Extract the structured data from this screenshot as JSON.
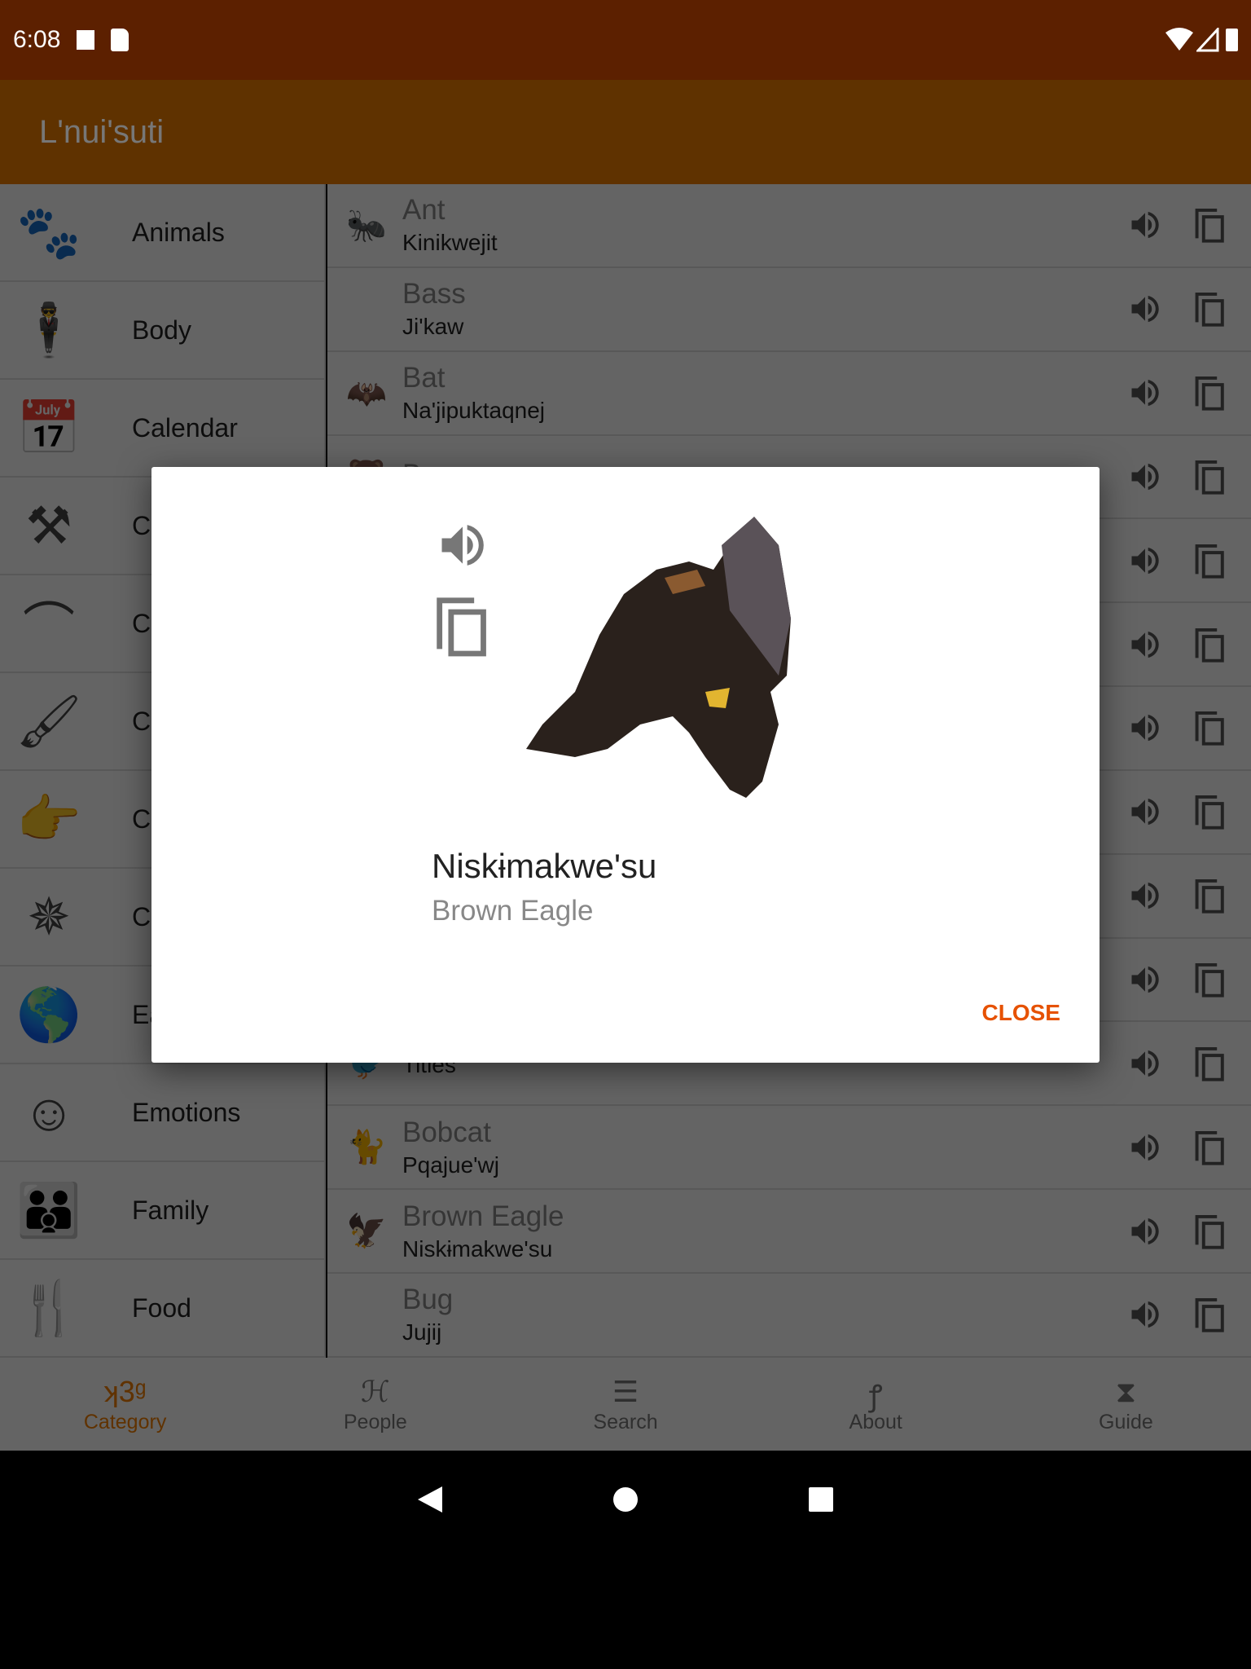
{
  "status_bar": {
    "time": "6:08"
  },
  "app_bar": {
    "title": "L'nui'suti"
  },
  "colors": {
    "status_bar": "#e65100",
    "app_bar": "#f07d00",
    "accent": "#e65100"
  },
  "sidebar": {
    "items": [
      {
        "label": "Animals",
        "icon": "animals-icon"
      },
      {
        "label": "Body",
        "icon": "body-icon"
      },
      {
        "label": "Calendar",
        "icon": "calendar-icon"
      },
      {
        "label": "Cl",
        "icon": "clans-icon"
      },
      {
        "label": "Cl",
        "icon": "hanger-icon"
      },
      {
        "label": "Co",
        "icon": "brush-icon"
      },
      {
        "label": "Co",
        "icon": "pointing-hand-icon"
      },
      {
        "label": "Co",
        "icon": "compass-icon"
      },
      {
        "label": "Ea",
        "icon": "globe-icon"
      },
      {
        "label": "Emotions",
        "icon": "faces-icon"
      },
      {
        "label": "Family",
        "icon": "family-icon"
      },
      {
        "label": "Food",
        "icon": "fork-knife-icon"
      }
    ]
  },
  "list": {
    "items": [
      {
        "en": "Ant",
        "mi": "Kinikwejit",
        "thumb": "🐜"
      },
      {
        "en": "Bass",
        "mi": "Ji'kaw",
        "thumb": ""
      },
      {
        "en": "Bat",
        "mi": "Na'jipuktaqnej",
        "thumb": "🦇"
      },
      {
        "en": "Bear",
        "mi": "",
        "thumb": "🐻"
      },
      {
        "en": "",
        "mi": "",
        "thumb": ""
      },
      {
        "en": "",
        "mi": "",
        "thumb": ""
      },
      {
        "en": "",
        "mi": "",
        "thumb": ""
      },
      {
        "en": "",
        "mi": "",
        "thumb": ""
      },
      {
        "en": "",
        "mi": "",
        "thumb": ""
      },
      {
        "en": "",
        "mi": "",
        "thumb": ""
      },
      {
        "en": "",
        "mi": "Tities",
        "thumb": "🐦"
      },
      {
        "en": "Bobcat",
        "mi": "Pqajue'wj",
        "thumb": "🐈"
      },
      {
        "en": "Brown Eagle",
        "mi": "Niskɨmakwe'su",
        "thumb": "🦅"
      },
      {
        "en": "Bug",
        "mi": "Jujij",
        "thumb": ""
      }
    ]
  },
  "bottom_nav": {
    "items": [
      {
        "label": "Category",
        "active": true
      },
      {
        "label": "People"
      },
      {
        "label": "Search"
      },
      {
        "label": "About"
      },
      {
        "label": "Guide"
      }
    ]
  },
  "dialog": {
    "word": "Niskɨmakwe'su",
    "translation": "Brown Eagle",
    "close_label": "CLOSE",
    "image": "brown-eagle"
  }
}
